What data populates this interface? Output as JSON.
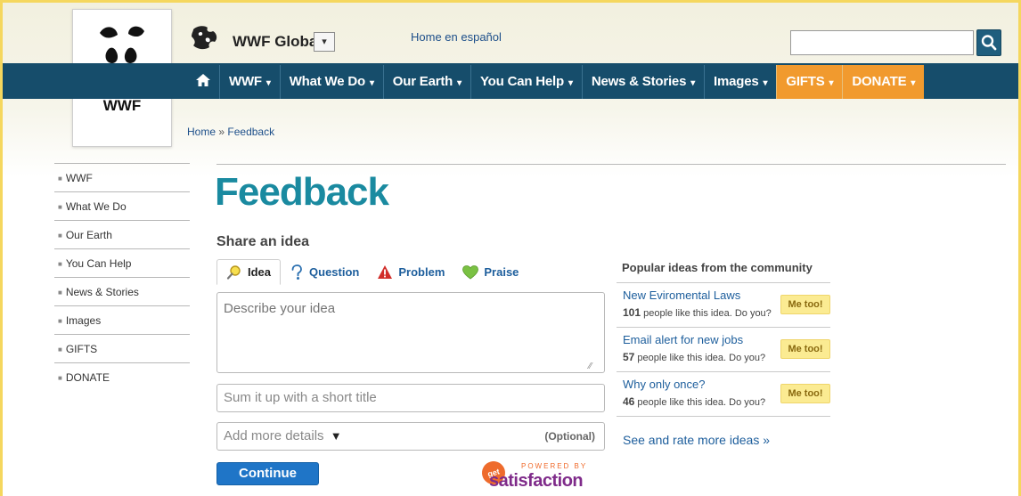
{
  "header": {
    "logo_text": "WWF",
    "site_title": "WWF Global",
    "site_dropdown_glyph": "▾",
    "home_es_link": "Home en español",
    "search": {
      "value": "",
      "placeholder": ""
    }
  },
  "nav": {
    "items": [
      {
        "label": "WWF"
      },
      {
        "label": "What We Do"
      },
      {
        "label": "Our Earth"
      },
      {
        "label": "You Can Help"
      },
      {
        "label": "News & Stories"
      },
      {
        "label": "Images"
      },
      {
        "label": "GIFTS"
      },
      {
        "label": "DONATE"
      }
    ],
    "caret": "▾",
    "home_icon": "house-icon",
    "accent_color": "#f19a2e",
    "bar_color": "#164d6b"
  },
  "breadcrumb": {
    "home": "Home",
    "separator": "»",
    "current": "Feedback"
  },
  "sidebar": {
    "items": [
      {
        "label": "WWF"
      },
      {
        "label": "What We Do"
      },
      {
        "label": "Our Earth"
      },
      {
        "label": "You Can Help"
      },
      {
        "label": "News & Stories"
      },
      {
        "label": "Images"
      },
      {
        "label": "GIFTS"
      },
      {
        "label": "DONATE"
      }
    ]
  },
  "main": {
    "title": "Feedback",
    "share_title": "Share an idea",
    "tabs": [
      {
        "label": "Idea",
        "icon": "magnifier-idea-icon"
      },
      {
        "label": "Question",
        "icon": "question-mark-icon"
      },
      {
        "label": "Problem",
        "icon": "warning-triangle-icon"
      },
      {
        "label": "Praise",
        "icon": "heart-icon"
      }
    ],
    "idea_placeholder": "Describe your idea",
    "title_placeholder": "Sum it up with a short title",
    "details_label": "Add more details",
    "details_optional": "(Optional)",
    "continue_label": "Continue",
    "powered": {
      "badge": "get",
      "powered_by": "POWERED BY",
      "brand": "satisfaction"
    }
  },
  "popular": {
    "title": "Popular ideas from the community",
    "items": [
      {
        "title": "New Eviromental Laws",
        "count": "101",
        "suffix": "people like this idea. Do you?",
        "button": "Me too!"
      },
      {
        "title": "Email alert for new jobs",
        "count": "57",
        "suffix": "people like this idea. Do you?",
        "button": "Me too!"
      },
      {
        "title": "Why only once?",
        "count": "46",
        "suffix": "people like this idea. Do you?",
        "button": "Me too!"
      }
    ],
    "see_more": "See and rate more ideas »"
  }
}
